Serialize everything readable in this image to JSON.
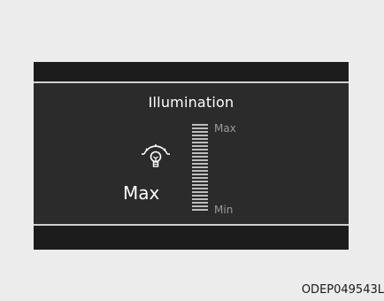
{
  "display": {
    "title": "Illumination",
    "current_level": "Max",
    "scale_max_label": "Max",
    "scale_min_label": "Min",
    "level_fraction": 1.0,
    "icon": "dashboard-illumination-icon"
  },
  "colors": {
    "display_background": "#2b2b2b",
    "bar_background": "#1c1c1c",
    "text": "#ffffff",
    "scale_segments": "#bdbdbd"
  },
  "caption": "ODEP049543L"
}
